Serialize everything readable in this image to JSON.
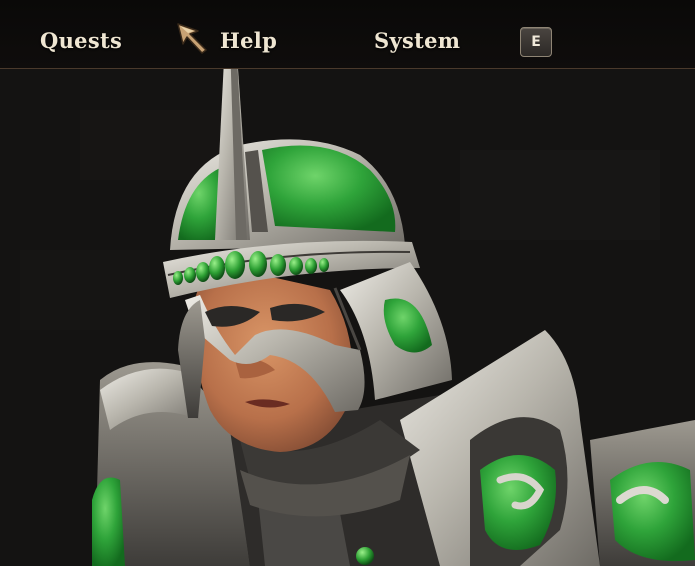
{
  "menu": {
    "quests_label": "Quests",
    "help_label": "Help",
    "system_label": "System"
  },
  "keybind": {
    "key_label": "E"
  },
  "colors": {
    "menu_text": "#efe6d2",
    "armor_green": "#2fa43a",
    "steel": "#c9c6be",
    "bar_border": "#4a3a2c"
  },
  "icons": [
    "mouse-cursor-icon"
  ]
}
